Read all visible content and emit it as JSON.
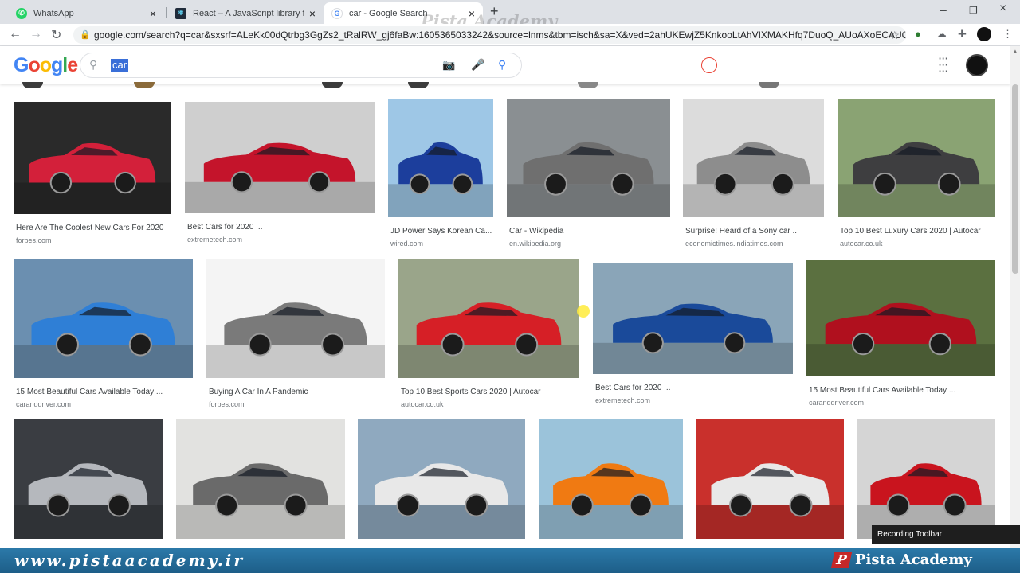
{
  "tabs": [
    {
      "title": "WhatsApp",
      "icon": "whatsapp-icon",
      "color": "#25d366",
      "active": false
    },
    {
      "title": "React – A JavaScript library for bu",
      "icon": "react-icon",
      "color": "#1f2b3a",
      "active": false
    },
    {
      "title": "car - Google Search",
      "icon": "google-icon",
      "color": "#4285f4",
      "active": true
    }
  ],
  "watermark": "Pista Academy",
  "address": {
    "url": "google.com/search?q=car&sxsrf=ALeKk00dQtrbg3GgZs2_tRalRW_gj6faBw:1605365033242&source=lnms&tbm=isch&sa=X&ved=2ahUKEwjZ5KnkooLtAhVIXMAKHfq7DuoQ_AUoAXoECAUQ..."
  },
  "search": {
    "query": "car"
  },
  "results": [
    {
      "title": "Here Are The Coolest New Cars For 2020",
      "site": "forbes.com",
      "color": "#d3203a",
      "bg": "#2a2a2a"
    },
    {
      "title": "Best Cars for 2020 ...",
      "site": "extremetech.com",
      "color": "#c4142b",
      "bg": "#cfcfcf"
    },
    {
      "title": "JD Power Says Korean Ca...",
      "site": "wired.com",
      "color": "#1c3e9c",
      "bg": "#9ec7e6"
    },
    {
      "title": "Car - Wikipedia",
      "site": "en.wikipedia.org",
      "color": "#6f6f6f",
      "bg": "#8a8f92"
    },
    {
      "title": "Surprise! Heard of a Sony car ...",
      "site": "economictimes.indiatimes.com",
      "color": "#8d8d8d",
      "bg": "#dcdcdc"
    },
    {
      "title": "Top 10 Best Luxury Cars 2020 | Autocar",
      "site": "autocar.co.uk",
      "color": "#3e3e40",
      "bg": "#8aa373"
    },
    {
      "title": "15 Most Beautiful Cars Available Today ...",
      "site": "caranddriver.com",
      "color": "#2f7fd6",
      "bg": "#6b8fb0"
    },
    {
      "title": "Buying A Car In A Pandemic",
      "site": "forbes.com",
      "color": "#7a7a7a",
      "bg": "#f4f4f4"
    },
    {
      "title": "Top 10 Best Sports Cars 2020 | Autocar",
      "site": "autocar.co.uk",
      "color": "#d61f26",
      "bg": "#9aa58a"
    },
    {
      "title": "Best Cars for 2020 ...",
      "site": "extremetech.com",
      "color": "#1a4a9a",
      "bg": "#8aa5b8"
    },
    {
      "title": "15 Most Beautiful Cars Available Today ...",
      "site": "caranddriver.com",
      "color": "#b0101e",
      "bg": "#5b7040"
    },
    {
      "title": "",
      "site": "",
      "color": "#b5b8bd",
      "bg": "#3a3d42"
    },
    {
      "title": "",
      "site": "",
      "color": "#6a6a6a",
      "bg": "#e2e2e0"
    },
    {
      "title": "",
      "site": "",
      "color": "#e8e8e8",
      "bg": "#8fa9bf"
    },
    {
      "title": "",
      "site": "",
      "color": "#f07a12",
      "bg": "#9bc3da"
    },
    {
      "title": "",
      "site": "",
      "color": "#e8e8e8",
      "bg": "#c9302c"
    },
    {
      "title": "",
      "site": "",
      "color": "#c9141e",
      "bg": "#d5d5d5"
    }
  ],
  "recording_toolbar": "Recording Toolbar",
  "footer": {
    "url": "www.pistaacademy.ir",
    "brand": "Pista Academy",
    "brand_mark": "P"
  }
}
